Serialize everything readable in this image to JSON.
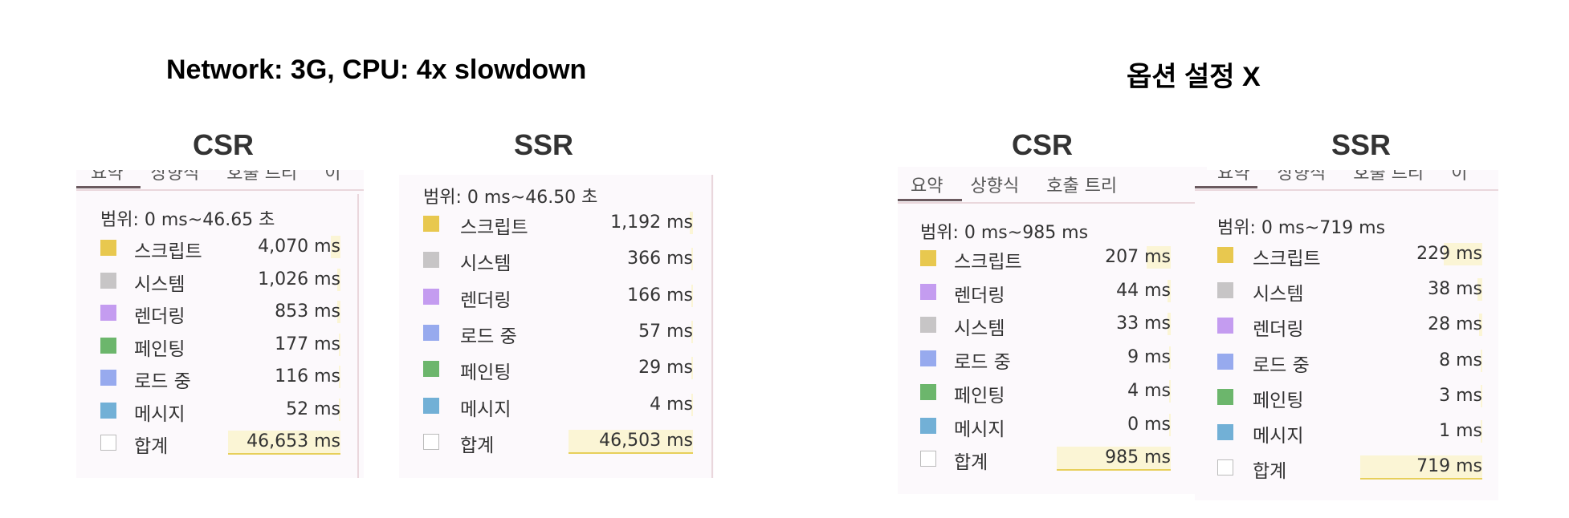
{
  "headings": {
    "left": "Network: 3G, CPU: 4x slowdown",
    "right": "옵션 설정 X"
  },
  "colors": {
    "script": "#e8c84f",
    "system": "#c7c5c6",
    "rendering": "#c49cf0",
    "painting": "#6cb66c",
    "loading": "#97aaee",
    "messaging": "#72b0d6",
    "total": "#ffffff"
  },
  "tab_labels": [
    "요약",
    "상향식",
    "호출 트리",
    "이"
  ],
  "panels": [
    {
      "title": "CSR",
      "range": "범위: 0 ms~46.65 초",
      "rows": [
        {
          "label": "스크립트",
          "value": "4,070 ms",
          "color": "#e8c84f"
        },
        {
          "label": "시스템",
          "value": "1,026 ms",
          "color": "#c7c5c6"
        },
        {
          "label": "렌더링",
          "value": "853 ms",
          "color": "#c49cf0"
        },
        {
          "label": "페인팅",
          "value": "177 ms",
          "color": "#6cb66c"
        },
        {
          "label": "로드 중",
          "value": "116 ms",
          "color": "#97aaee"
        },
        {
          "label": "메시지",
          "value": "52 ms",
          "color": "#72b0d6"
        },
        {
          "label": "합계",
          "value": "46,653 ms",
          "color": "#ffffff"
        }
      ]
    },
    {
      "title": "SSR",
      "range": "범위: 0 ms~46.50 초",
      "rows": [
        {
          "label": "스크립트",
          "value": "1,192 ms",
          "color": "#e8c84f"
        },
        {
          "label": "시스템",
          "value": "366 ms",
          "color": "#c7c5c6"
        },
        {
          "label": "렌더링",
          "value": "166 ms",
          "color": "#c49cf0"
        },
        {
          "label": "로드 중",
          "value": "57 ms",
          "color": "#97aaee"
        },
        {
          "label": "페인팅",
          "value": "29 ms",
          "color": "#6cb66c"
        },
        {
          "label": "메시지",
          "value": "4 ms",
          "color": "#72b0d6"
        },
        {
          "label": "합계",
          "value": "46,503 ms",
          "color": "#ffffff"
        }
      ]
    },
    {
      "title": "CSR",
      "range": "범위: 0 ms~985 ms",
      "rows": [
        {
          "label": "스크립트",
          "value": "207 ms",
          "color": "#e8c84f"
        },
        {
          "label": "렌더링",
          "value": "44 ms",
          "color": "#c49cf0"
        },
        {
          "label": "시스템",
          "value": "33 ms",
          "color": "#c7c5c6"
        },
        {
          "label": "로드 중",
          "value": "9 ms",
          "color": "#97aaee"
        },
        {
          "label": "페인팅",
          "value": "4 ms",
          "color": "#6cb66c"
        },
        {
          "label": "메시지",
          "value": "0 ms",
          "color": "#72b0d6"
        },
        {
          "label": "합계",
          "value": "985 ms",
          "color": "#ffffff"
        }
      ]
    },
    {
      "title": "SSR",
      "range": "범위: 0 ms~719 ms",
      "rows": [
        {
          "label": "스크립트",
          "value": "229 ms",
          "color": "#e8c84f"
        },
        {
          "label": "시스템",
          "value": "38 ms",
          "color": "#c7c5c6"
        },
        {
          "label": "렌더링",
          "value": "28 ms",
          "color": "#c49cf0"
        },
        {
          "label": "로드 중",
          "value": "8 ms",
          "color": "#97aaee"
        },
        {
          "label": "페인팅",
          "value": "3 ms",
          "color": "#6cb66c"
        },
        {
          "label": "메시지",
          "value": "1 ms",
          "color": "#72b0d6"
        },
        {
          "label": "합계",
          "value": "719 ms",
          "color": "#ffffff"
        }
      ]
    }
  ]
}
